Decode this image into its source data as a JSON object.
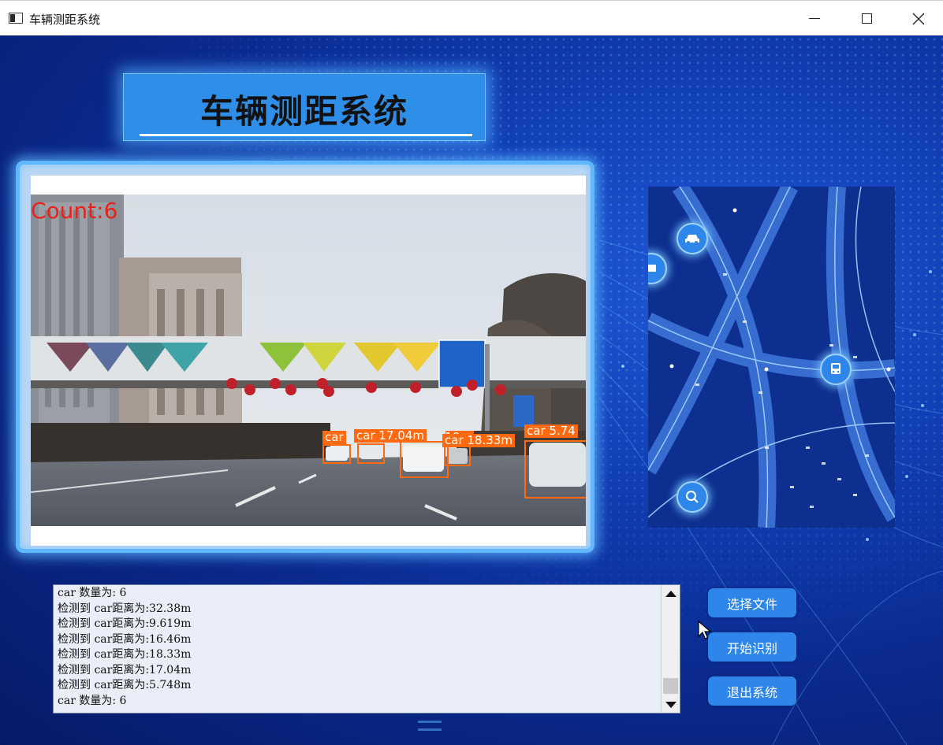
{
  "window": {
    "title": "车辆测距系统",
    "controls": [
      "minimize",
      "maximize",
      "close"
    ]
  },
  "header": {
    "title": "车辆测距系统"
  },
  "video": {
    "count_label": "Count:6",
    "detections": [
      {
        "label": "car"
      },
      {
        "label": "car 17.04m"
      },
      {
        "label": "car 9.619m"
      },
      {
        "label": "car 18.33m"
      },
      {
        "label": "car 5.74"
      }
    ]
  },
  "side_panel": {
    "icons": [
      "car-icon",
      "bus-icon",
      "search-icon",
      "truck-icon"
    ]
  },
  "log": {
    "lines": [
      "car 数量为: 6",
      "检测到 car距离为:32.38m",
      "检测到 car距离为:9.619m",
      "检测到 car距离为:16.46m",
      "检测到 car距离为:18.33m",
      "检测到 car距离为:17.04m",
      "检测到 car距离为:5.748m",
      "car 数量为: 6"
    ]
  },
  "buttons": {
    "select_file": "选择文件",
    "start": "开始识别",
    "exit": "退出系统"
  },
  "colors": {
    "accent": "#2f86ea",
    "detection": "#ff6a10",
    "count": "#e8221b"
  }
}
